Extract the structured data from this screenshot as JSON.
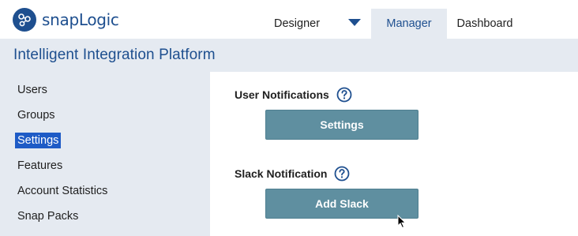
{
  "header": {
    "logo_text": "snapLogic",
    "nav": {
      "designer": "Designer",
      "manager": "Manager",
      "dashboard": "Dashboard"
    }
  },
  "banner": {
    "title": "Intelligent Integration Platform"
  },
  "sidebar": {
    "items": [
      {
        "label": "Users"
      },
      {
        "label": "Groups"
      },
      {
        "label": "Settings"
      },
      {
        "label": "Features"
      },
      {
        "label": "Account Statistics"
      },
      {
        "label": "Snap Packs"
      }
    ],
    "active_item": "Settings"
  },
  "main": {
    "user_notifications": {
      "label": "User Notifications",
      "button_label": "Settings"
    },
    "slack_notification": {
      "label": "Slack Notification",
      "button_label": "Add Slack"
    }
  },
  "icons": {
    "logo": "snaplogic-logo-icon",
    "dropdown": "caret-down-icon",
    "help": "question-circle-icon",
    "cursor": "mouse-pointer-icon"
  },
  "colors": {
    "brand_blue": "#1e4f8f",
    "light_panel": "#e5eaf1",
    "button": "#5f8fa0",
    "active_highlight": "#1e5bc6"
  }
}
